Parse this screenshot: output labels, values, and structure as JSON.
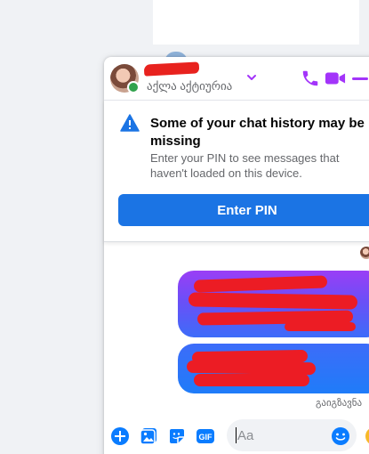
{
  "chat": {
    "status": "აქლა აქტიურია",
    "header_icons": [
      "chevron-down-icon",
      "phone-icon",
      "video-camera-icon",
      "minimize-icon"
    ]
  },
  "history_notice": {
    "title": "Some of your chat history may be missing",
    "body": "Enter your PIN to see messages that haven't loaded on this device.",
    "button_label": "Enter PIN"
  },
  "messages": {
    "seen_label": "გაიგზავნა"
  },
  "composer": {
    "placeholder": "Aa",
    "icons": [
      "plus-circle-icon",
      "photo-icon",
      "sticker-icon",
      "gif-icon",
      "emoji-icon",
      "like-icon"
    ],
    "gif_label": "GIF"
  },
  "colors": {
    "accent": "#a334fa",
    "button_blue": "#1b74e4",
    "composer_blue": "#0a7cff",
    "online_green": "#31a24c",
    "redaction_red": "#ec1c24"
  }
}
